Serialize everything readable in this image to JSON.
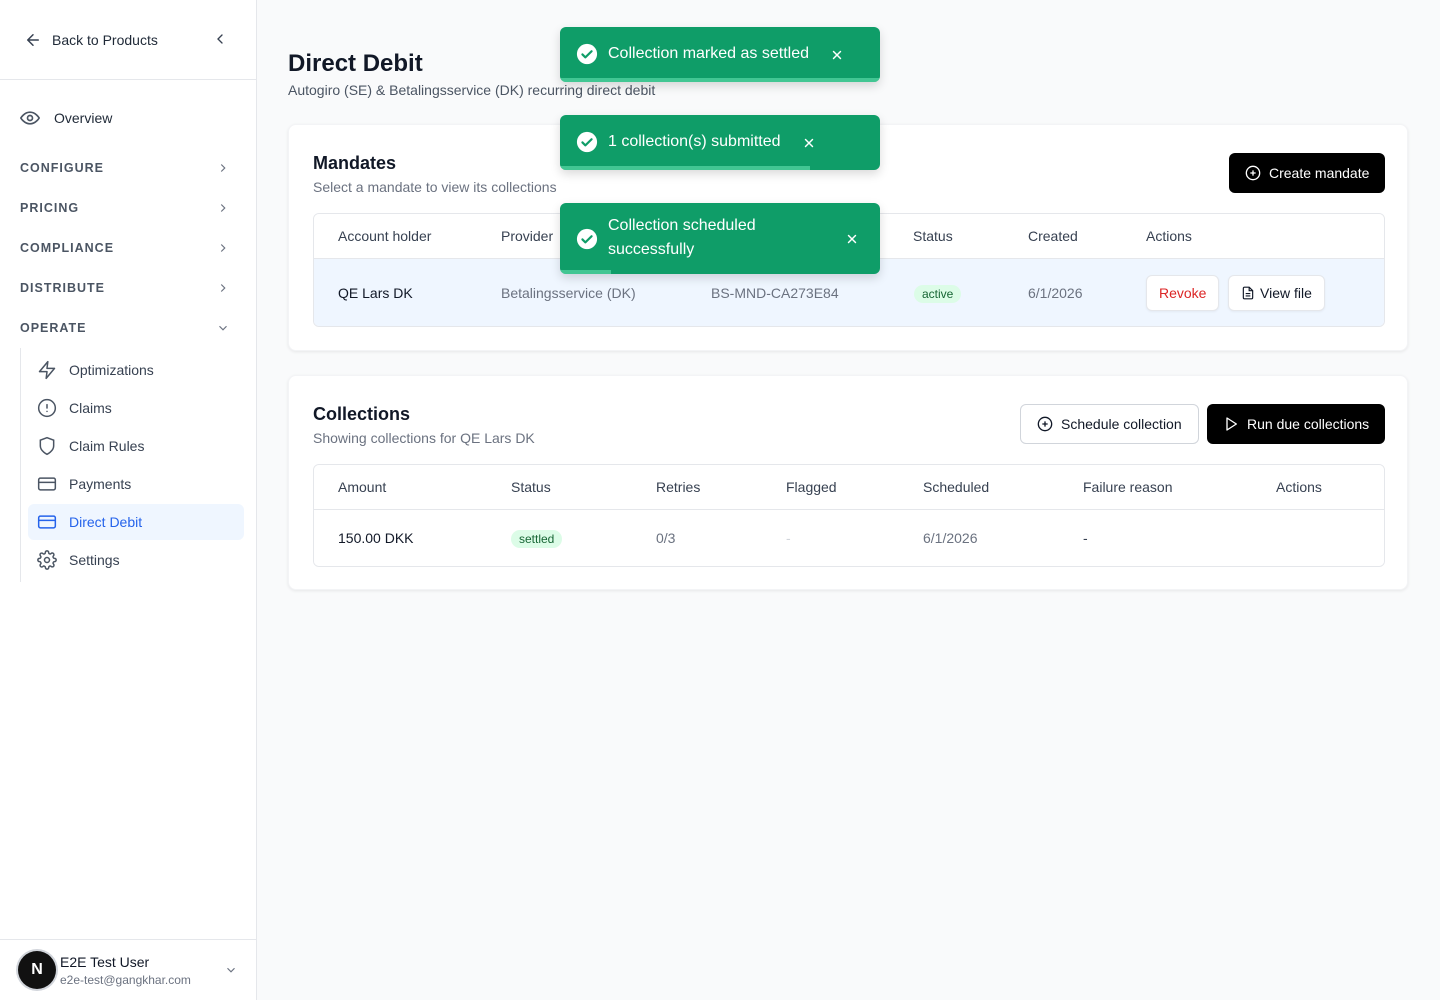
{
  "sidebar": {
    "back_label": "Back to Products",
    "overview_label": "Overview",
    "sections": [
      {
        "label": "CONFIGURE"
      },
      {
        "label": "PRICING"
      },
      {
        "label": "COMPLIANCE"
      },
      {
        "label": "DISTRIBUTE"
      },
      {
        "label": "OPERATE"
      }
    ],
    "operate_items": [
      {
        "label": "Optimizations",
        "icon": "lightning-icon"
      },
      {
        "label": "Claims",
        "icon": "alert-circle-icon"
      },
      {
        "label": "Claim Rules",
        "icon": "shield-icon"
      },
      {
        "label": "Payments",
        "icon": "credit-card-icon"
      },
      {
        "label": "Direct Debit",
        "icon": "credit-card-icon",
        "active": true
      },
      {
        "label": "Settings",
        "icon": "gear-icon"
      }
    ],
    "user": {
      "initial": "N",
      "name": "E2E Test User",
      "email": "e2e-test@gangkhar.com"
    }
  },
  "page": {
    "title": "Direct Debit",
    "subtitle": "Autogiro (SE) & Betalingsservice (DK) recurring direct debit"
  },
  "mandates": {
    "title": "Mandates",
    "subtitle": "Select a mandate to view its collections",
    "create_label": "Create mandate",
    "columns": [
      "Account holder",
      "Provider",
      "Status",
      "Created",
      "Actions"
    ],
    "row": {
      "account_holder": "QE Lars DK",
      "provider": "Betalingsservice (DK)",
      "reference": "BS-MND-CA273E84",
      "status": "active",
      "created": "6/1/2026",
      "revoke_label": "Revoke",
      "view_file_label": "View file"
    }
  },
  "collections": {
    "title": "Collections",
    "subtitle": "Showing collections for QE Lars DK",
    "schedule_label": "Schedule collection",
    "run_label": "Run due collections",
    "columns": [
      "Amount",
      "Status",
      "Retries",
      "Flagged",
      "Scheduled",
      "Failure reason",
      "Actions"
    ],
    "row": {
      "amount": "150.00 DKK",
      "status": "settled",
      "retries": "0/3",
      "flagged": "-",
      "scheduled": "6/1/2026",
      "failure_reason": "-"
    }
  },
  "toasts": [
    {
      "message": "Collection marked as settled",
      "progress": 1.0
    },
    {
      "message": "1 collection(s) submitted",
      "progress": 0.78
    },
    {
      "message": "Collection scheduled successfully",
      "progress": 0.16
    }
  ],
  "colors": {
    "toast_bg": "#0f9d68",
    "active_nav": "#2563eb",
    "revoke": "#dc2626",
    "primary_button": "#000000"
  }
}
